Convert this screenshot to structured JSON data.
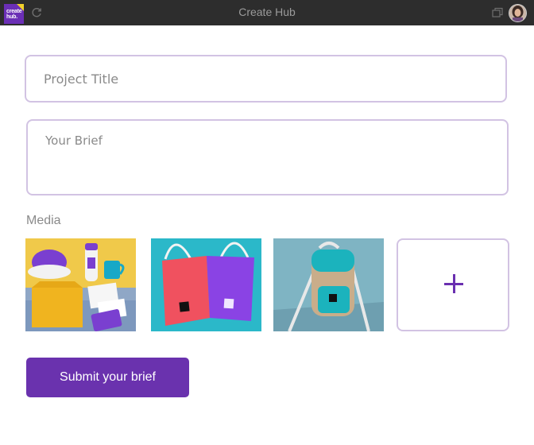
{
  "window": {
    "title": "Create Hub",
    "logo_text_line1": "create",
    "logo_text_line2": "hub."
  },
  "form": {
    "title_placeholder": "Project Title",
    "brief_placeholder": "Your Brief",
    "media_label": "Media",
    "submit_label": "Submit your brief"
  },
  "media": {
    "items": [
      {
        "description_icon": "branded-merchandise-photo"
      },
      {
        "description_icon": "tote-bags-photo"
      },
      {
        "description_icon": "backpack-photo"
      }
    ],
    "add_icon": "plus-icon"
  },
  "colors": {
    "accent": "#6a32ae",
    "field_border": "#d2c3e3",
    "titlebar": "#2d2d2d"
  }
}
